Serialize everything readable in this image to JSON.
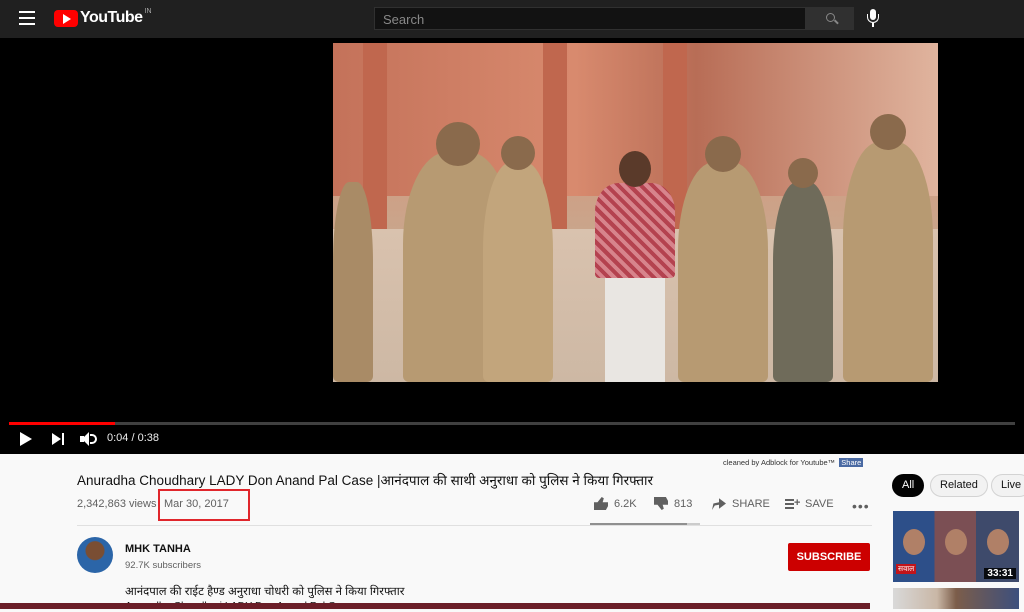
{
  "header": {
    "logo_text": "YouTube",
    "logo_region": "IN",
    "search_placeholder": "Search"
  },
  "player": {
    "current_time": "0:04 / 0:38",
    "progress_fraction": 0.105
  },
  "adblock": {
    "text": "cleaned by Adblock for Youtube™",
    "link": "Share"
  },
  "video": {
    "title": "Anuradha Choudhary LADY Don Anand Pal Case |आनंदपाल की साथी अनुराधा को पुलिस ने किया गिरफ्तार",
    "views": "2,342,863 views",
    "date": "Mar 30, 2017",
    "likes": "6.2K",
    "dislikes": "813",
    "share_label": "SHARE",
    "save_label": "SAVE",
    "more_label": "•••",
    "like_ratio": 0.88
  },
  "channel": {
    "name": "MHK TANHA",
    "subscribers": "92.7K subscribers",
    "subscribe_label": "SUBSCRIBE"
  },
  "description": {
    "line1": "आनंदपाल की राईट हैण्ड अनुराधा चोधरी को पुलिस ने किया गिरफ्तार",
    "line2": "Anuradha Choudhari LADY Don Anand Pal Case"
  },
  "sidebar": {
    "chips": [
      "All",
      "Related",
      "Live"
    ],
    "recommendations": [
      {
        "caption": "सवाल",
        "duration": "33:31"
      }
    ]
  },
  "colors": {
    "brand_red": "#ff0000",
    "subscribe_red": "#cc0000",
    "highlight_box": "#e0262c"
  }
}
